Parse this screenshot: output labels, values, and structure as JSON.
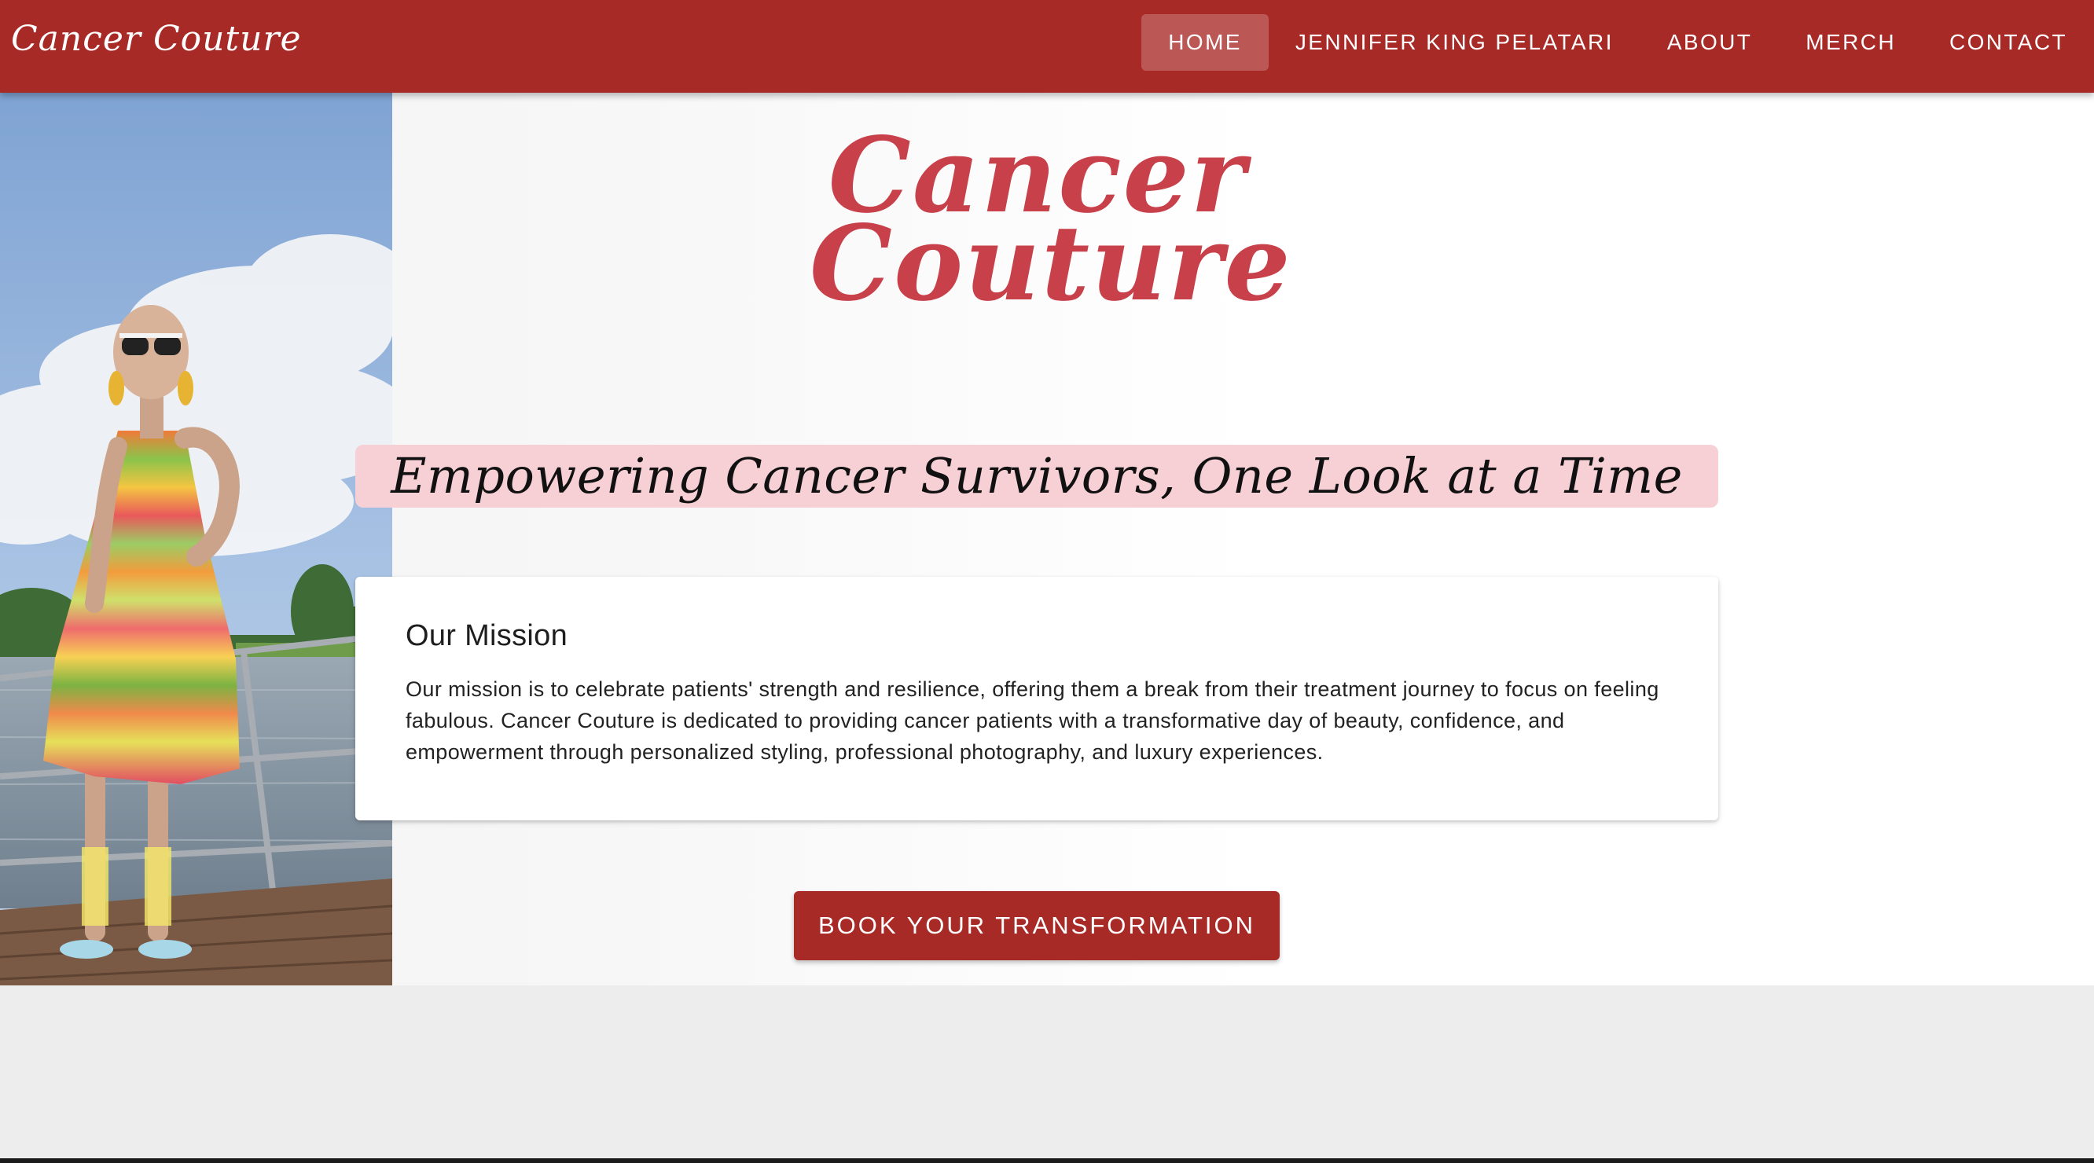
{
  "header": {
    "brand": "Cancer Couture",
    "nav": [
      {
        "label": "HOME",
        "active": true
      },
      {
        "label": "JENNIFER KING PELATARI",
        "active": false
      },
      {
        "label": "ABOUT",
        "active": false
      },
      {
        "label": "MERCH",
        "active": false
      },
      {
        "label": "CONTACT",
        "active": false
      }
    ]
  },
  "hero": {
    "logo_line1": "Cancer",
    "logo_line2": "Couture",
    "tagline": "Empowering Cancer Survivors, One Look at a Time",
    "mission": {
      "title": "Our Mission",
      "text": "Our mission is to celebrate patients' strength and resilience, offering them a break from their treatment journey to focus on feeling fabulous. Cancer Couture is dedicated to providing cancer patients with a transformative day of beauty, confidence, and empowerment through personalized styling, professional photography, and luxury experiences."
    },
    "cta_label": "BOOK YOUR TRANSFORMATION"
  },
  "colors": {
    "primary": "#a82a27",
    "logo": "#c8404a",
    "tagline_bg": "#f7d0d6",
    "page_bg": "#ededed"
  }
}
